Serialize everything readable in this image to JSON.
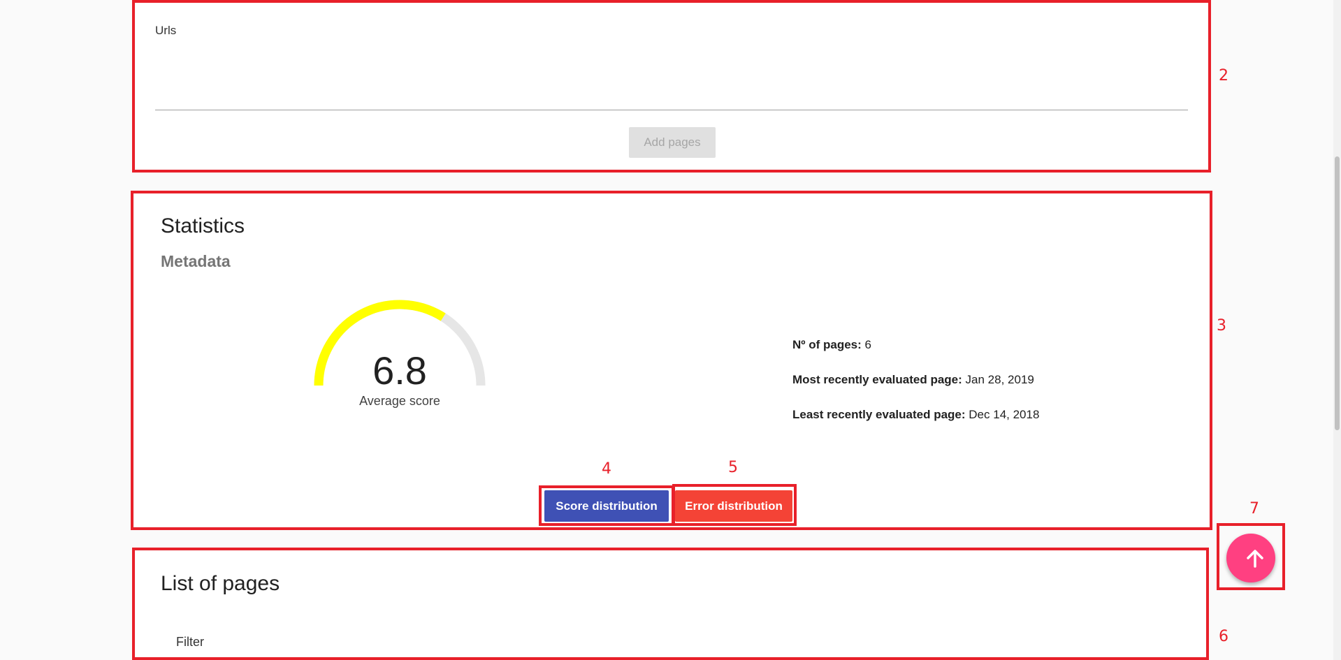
{
  "url_section": {
    "label": "Urls",
    "add_button": "Add pages"
  },
  "statistics": {
    "title": "Statistics",
    "subtitle": "Metadata",
    "average_score": "6.8",
    "average_score_value": 6.8,
    "average_score_max": 10,
    "average_score_label": "Average score",
    "gauge_color": "#ffff00",
    "info": [
      {
        "label": "Nº of pages:",
        "value": "6"
      },
      {
        "label": "Most recently evaluated page:",
        "value": "Jan 28, 2019"
      },
      {
        "label": "Least recently evaluated page:",
        "value": "Dec 14, 2018"
      }
    ],
    "score_distribution_button": "Score distribution",
    "error_distribution_button": "Error distribution"
  },
  "pages_list": {
    "title": "List of pages",
    "filter_label": "Filter"
  },
  "fab": {
    "icon": "arrow-up-icon"
  },
  "annotations": [
    "2",
    "3",
    "4",
    "5",
    "6",
    "7"
  ],
  "colors": {
    "annotation": "#e8202a",
    "primary": "#3f51b5",
    "warn": "#f44336",
    "accent": "#ff4081"
  }
}
